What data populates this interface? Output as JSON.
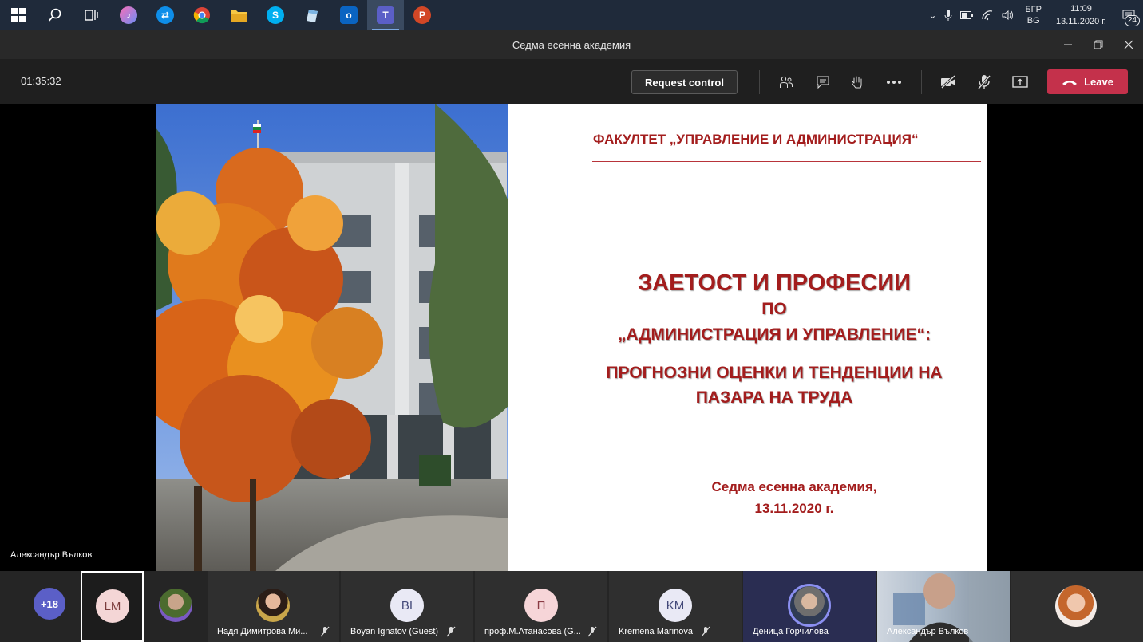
{
  "taskbar": {
    "apps": [
      {
        "name": "start-icon"
      },
      {
        "name": "search-icon"
      },
      {
        "name": "task-view-icon"
      },
      {
        "name": "itunes-icon"
      },
      {
        "name": "teamviewer-icon"
      },
      {
        "name": "chrome-icon"
      },
      {
        "name": "file-explorer-icon"
      },
      {
        "name": "skype-icon"
      },
      {
        "name": "notes-app-icon"
      },
      {
        "name": "outlook-icon"
      },
      {
        "name": "teams-icon"
      },
      {
        "name": "powerpoint-icon"
      }
    ],
    "tray": {
      "lang_top": "БГР",
      "lang_bottom": "BG",
      "time": "11:09",
      "date": "13.11.2020 г.",
      "notifications": "24"
    }
  },
  "window": {
    "title": "Седма есенна академия"
  },
  "meeting": {
    "timer": "01:35:32",
    "request_control": "Request control",
    "leave": "Leave",
    "leave_color": "#c4314b"
  },
  "slide": {
    "heading": "ФАКУЛТЕТ „УПРАВЛЕНИЕ И АДМИНИСТРАЦИЯ“",
    "title_line1": "ЗАЕТОСТ И ПРОФЕСИИ",
    "title_line2": "ПО",
    "title_line3": "„АДМИНИСТРАЦИЯ И УПРАВЛЕНИЕ“:",
    "title_line4": "ПРОГНОЗНИ ОЦЕНКИ И ТЕНДЕНЦИИ НА",
    "title_line5": "ПАЗАРА НА ТРУДА",
    "footer_line1": "Седма есенна академия,",
    "footer_line2": "13.11.2020 г.",
    "accent_color": "#a31d1d"
  },
  "presenter": {
    "name": "Александър Вълков"
  },
  "participants": {
    "more": "+18",
    "tiles": [
      {
        "initials": "LM",
        "name": ""
      },
      {
        "initials": "",
        "name": ""
      },
      {
        "initials": "",
        "name": "Надя Димитрова Ми..."
      },
      {
        "initials": "BI",
        "name": "Boyan Ignatov (Guest)"
      },
      {
        "initials": "П",
        "name": "проф.М.Атанасова (G..."
      },
      {
        "initials": "KM",
        "name": "Kremena Marinova"
      },
      {
        "initials": "",
        "name": "Деница Горчилова"
      },
      {
        "initials": "",
        "name": "Александър Вълков"
      },
      {
        "initials": "",
        "name": ""
      }
    ]
  }
}
